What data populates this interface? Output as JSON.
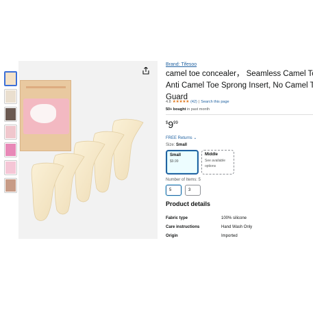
{
  "thumbnails": [
    {
      "name": "thumb-1",
      "color": "#f4e2c8",
      "active": true
    },
    {
      "name": "thumb-2",
      "color": "#eadfcf"
    },
    {
      "name": "thumb-3",
      "color": "#6b5a52"
    },
    {
      "name": "thumb-4",
      "color": "#f0c7cd"
    },
    {
      "name": "thumb-5",
      "color": "#e888b7"
    },
    {
      "name": "thumb-6",
      "color": "#f5c6d6"
    },
    {
      "name": "thumb-7",
      "color": "#c79b86"
    }
  ],
  "product": {
    "brand": "Brand: Tifesoo",
    "title_lines": [
      "camel toe concealer， Seamless Camel Toe",
      "Anti Camel Toe Sprong Insert, No Camel T",
      "Guard"
    ],
    "rating_value": "4.8",
    "stars": "★★★★★",
    "rating_count": "(42)",
    "search_link": "Search this page",
    "bought_bold": "50+ bought",
    "bought_rest": " in past month",
    "price_symbol": "$",
    "price_whole": "9",
    "price_fraction": "99",
    "returns": "FREE Returns",
    "size_label": "Size: ",
    "size_selected": "Small",
    "sizes": [
      {
        "name": "Small",
        "sub": "$9.99"
      },
      {
        "name": "Middle",
        "sub": "See available options"
      }
    ],
    "items_label": "Number of Items: 5",
    "quantities": [
      "5",
      "3"
    ]
  },
  "details": {
    "title": "Product details",
    "rows": [
      {
        "key": "Fabric type",
        "value": "100% silicone"
      },
      {
        "key": "Care instructions",
        "value": "Hand Wash Only"
      },
      {
        "key": "Origin",
        "value": "Imported"
      }
    ]
  },
  "colors": {
    "link": "#2162a1",
    "star": "#de7921",
    "selected_border": "#2162a1"
  }
}
